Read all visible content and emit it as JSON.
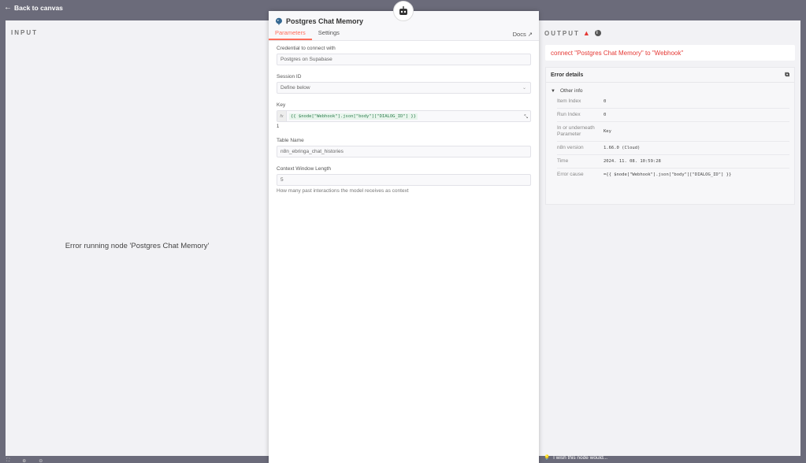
{
  "nav": {
    "back_label": "Back to canvas"
  },
  "input_panel": {
    "heading": "INPUT",
    "error_message": "Error running node 'Postgres Chat Memory'"
  },
  "node": {
    "title": "Postgres Chat Memory",
    "tabs": [
      {
        "label": "Parameters",
        "active": true
      },
      {
        "label": "Settings",
        "active": false
      }
    ],
    "docs_label": "Docs",
    "fields": {
      "credential": {
        "label": "Credential to connect with",
        "value": "Postgres on Supabase"
      },
      "session_id": {
        "label": "Session ID",
        "value": "Define below"
      },
      "key": {
        "label": "Key",
        "expression": "{{ $node[\"Webhook\"].json[\"body\"][\"DIALOG_ID\"] }}",
        "result": "1"
      },
      "table_name": {
        "label": "Table Name",
        "value": "n8n_ebringa_chat_histories"
      },
      "context_window": {
        "label": "Context Window Length",
        "value": "5",
        "hint": "How many past interactions the model receives as context"
      }
    }
  },
  "output_panel": {
    "heading": "OUTPUT",
    "error_message": "connect \"Postgres Chat Memory\" to \"Webhook\"",
    "details_title": "Error details",
    "other_info_label": "Other info",
    "rows": [
      {
        "key": "Item Index",
        "value": "0"
      },
      {
        "key": "Run Index",
        "value": "0"
      },
      {
        "key": "In or underneath Parameter",
        "value": "Key"
      },
      {
        "key": "n8n version",
        "value": "1.66.0 (Cloud)"
      },
      {
        "key": "Time",
        "value": "2024. 11. 08. 10:59:28"
      },
      {
        "key": "Error cause",
        "value": "={{ $node[\"Webhook\"].json[\"body\"][\"DIALOG_ID\"] }}"
      }
    ]
  },
  "feedback": {
    "label": "I wish this node would..."
  },
  "colors": {
    "accent": "#ff6d5a",
    "error": "#e53935",
    "backdrop": "#6b6b7a"
  }
}
